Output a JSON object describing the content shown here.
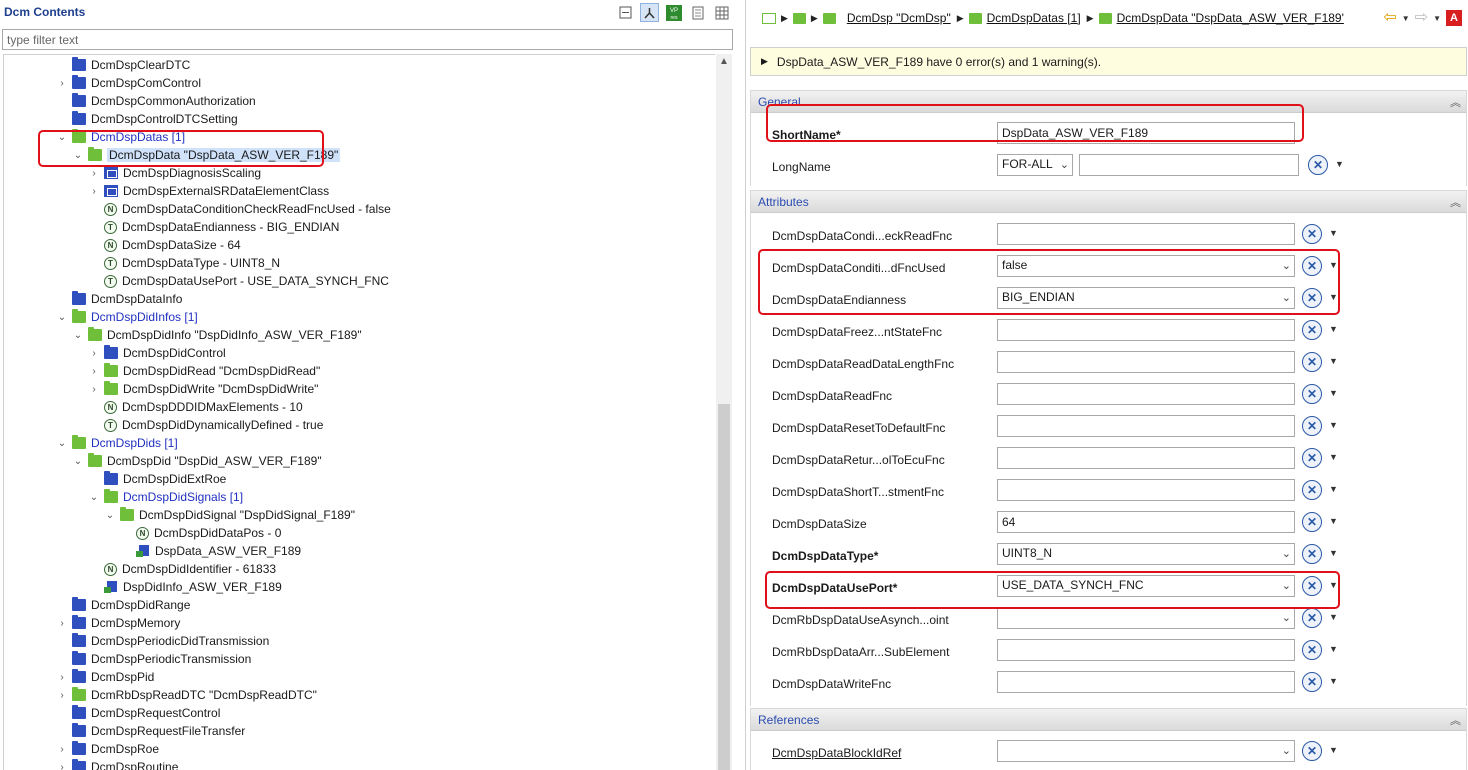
{
  "left": {
    "title": "Dcm Contents",
    "filter_placeholder": "type filter text",
    "toolbar": {
      "collapse_icon": "collapse-all-icon",
      "link_icon": "link-with-editor-icon",
      "vp_label": "VP res",
      "doc_icon": "document-icon",
      "grid_icon": "table-icon"
    },
    "tree": [
      {
        "label": "DcmDspClearDTC",
        "icon": "folder-blue",
        "indent": 0,
        "twisty": ""
      },
      {
        "label": "DcmDspComControl",
        "icon": "folder-blue",
        "indent": 0,
        "twisty": "›"
      },
      {
        "label": "DcmDspCommonAuthorization",
        "icon": "folder-blue",
        "indent": 0,
        "twisty": ""
      },
      {
        "label": "DcmDspControlDTCSetting",
        "icon": "folder-blue",
        "indent": 0,
        "twisty": ""
      },
      {
        "label": "DcmDspDatas [1]",
        "icon": "folder-green",
        "indent": 0,
        "twisty": "⌄",
        "style": "blue"
      },
      {
        "label": "DcmDspData \"DspData_ASW_VER_F189\"",
        "icon": "folder-green",
        "indent": 1,
        "twisty": "⌄",
        "style": "selected"
      },
      {
        "label": "DcmDspDiagnosisScaling",
        "icon": "grid",
        "indent": 2,
        "twisty": "›"
      },
      {
        "label": "DcmDspExternalSRDataElementClass",
        "icon": "grid",
        "indent": 2,
        "twisty": "›"
      },
      {
        "label": "DcmDspDataConditionCheckReadFncUsed - false",
        "icon": "N",
        "indent": 2,
        "twisty": ""
      },
      {
        "label": "DcmDspDataEndianness - BIG_ENDIAN",
        "icon": "T",
        "indent": 2,
        "twisty": ""
      },
      {
        "label": "DcmDspDataSize - 64",
        "icon": "N",
        "indent": 2,
        "twisty": ""
      },
      {
        "label": "DcmDspDataType - UINT8_N",
        "icon": "T",
        "indent": 2,
        "twisty": ""
      },
      {
        "label": "DcmDspDataUsePort - USE_DATA_SYNCH_FNC",
        "icon": "T",
        "indent": 2,
        "twisty": ""
      },
      {
        "label": "DcmDspDataInfo",
        "icon": "folder-blue",
        "indent": 0,
        "twisty": ""
      },
      {
        "label": "DcmDspDidInfos [1]",
        "icon": "folder-green",
        "indent": 0,
        "twisty": "⌄",
        "style": "blue"
      },
      {
        "label": "DcmDspDidInfo \"DspDidInfo_ASW_VER_F189\"",
        "icon": "folder-green",
        "indent": 1,
        "twisty": "⌄"
      },
      {
        "label": "DcmDspDidControl",
        "icon": "folder-blue",
        "indent": 2,
        "twisty": "›"
      },
      {
        "label": "DcmDspDidRead \"DcmDspDidRead\"",
        "icon": "folder-green",
        "indent": 2,
        "twisty": "›"
      },
      {
        "label": "DcmDspDidWrite \"DcmDspDidWrite\"",
        "icon": "folder-green",
        "indent": 2,
        "twisty": "›"
      },
      {
        "label": "DcmDspDDDIDMaxElements - 10",
        "icon": "N",
        "indent": 2,
        "twisty": ""
      },
      {
        "label": "DcmDspDidDynamicallyDefined - true",
        "icon": "T",
        "indent": 2,
        "twisty": ""
      },
      {
        "label": "DcmDspDids [1]",
        "icon": "folder-green",
        "indent": 0,
        "twisty": "⌄",
        "style": "blue"
      },
      {
        "label": "DcmDspDid \"DspDid_ASW_VER_F189\"",
        "icon": "folder-green",
        "indent": 1,
        "twisty": "⌄"
      },
      {
        "label": "DcmDspDidExtRoe",
        "icon": "folder-blue",
        "indent": 2,
        "twisty": ""
      },
      {
        "label": "DcmDspDidSignals [1]",
        "icon": "folder-green",
        "indent": 2,
        "twisty": "⌄",
        "style": "blue"
      },
      {
        "label": "DcmDspDidSignal \"DspDidSignal_F189\"",
        "icon": "folder-green",
        "indent": 3,
        "twisty": "⌄"
      },
      {
        "label": "DcmDspDidDataPos - 0",
        "icon": "N",
        "indent": 4,
        "twisty": ""
      },
      {
        "label": "DspData_ASW_VER_F189",
        "icon": "ref",
        "indent": 4,
        "twisty": ""
      },
      {
        "label": "DcmDspDidIdentifier - 61833",
        "icon": "N",
        "indent": 2,
        "twisty": ""
      },
      {
        "label": "DspDidInfo_ASW_VER_F189",
        "icon": "ref",
        "indent": 2,
        "twisty": ""
      },
      {
        "label": "DcmDspDidRange",
        "icon": "folder-blue",
        "indent": 0,
        "twisty": ""
      },
      {
        "label": "DcmDspMemory",
        "icon": "folder-blue",
        "indent": 0,
        "twisty": "›"
      },
      {
        "label": "DcmDspPeriodicDidTransmission",
        "icon": "folder-blue",
        "indent": 0,
        "twisty": ""
      },
      {
        "label": "DcmDspPeriodicTransmission",
        "icon": "folder-blue",
        "indent": 0,
        "twisty": ""
      },
      {
        "label": "DcmDspPid",
        "icon": "folder-blue",
        "indent": 0,
        "twisty": "›"
      },
      {
        "label": "DcmRbDspReadDTC \"DcmDspReadDTC\"",
        "icon": "folder-green",
        "indent": 0,
        "twisty": "›"
      },
      {
        "label": "DcmDspRequestControl",
        "icon": "folder-blue",
        "indent": 0,
        "twisty": ""
      },
      {
        "label": "DcmDspRequestFileTransfer",
        "icon": "folder-blue",
        "indent": 0,
        "twisty": ""
      },
      {
        "label": "DcmDspRoe",
        "icon": "folder-blue",
        "indent": 0,
        "twisty": "›"
      },
      {
        "label": "DcmDspRoutine",
        "icon": "folder-blue",
        "indent": 0,
        "twisty": "›"
      }
    ]
  },
  "right": {
    "breadcrumb": [
      {
        "label": "DcmDsp \"DcmDsp\""
      },
      {
        "label": "DcmDspDatas [1]"
      },
      {
        "label": "DcmDspData \"DspData_ASW_VER_F189'"
      }
    ],
    "message": "DspData_ASW_VER_F189 have 0 error(s) and 1 warning(s).",
    "error_badge": "A",
    "sections": {
      "general": {
        "title": "General",
        "shortname_label": "ShortName*",
        "shortname_value": "DspData_ASW_VER_F189",
        "longname_label": "LongName",
        "longname_lang": "FOR-ALL",
        "longname_value": ""
      },
      "attributes": {
        "title": "Attributes",
        "rows": [
          {
            "label": "DcmDspDataCondi...eckReadFnc",
            "kind": "text",
            "value": "",
            "bold": false
          },
          {
            "label": "DcmDspDataConditi...dFncUsed",
            "kind": "combo",
            "value": "false",
            "bold": false
          },
          {
            "label": "DcmDspDataEndianness",
            "kind": "combo",
            "value": "BIG_ENDIAN",
            "bold": false
          },
          {
            "label": "DcmDspDataFreez...ntStateFnc",
            "kind": "text",
            "value": "",
            "bold": false
          },
          {
            "label": "DcmDspDataReadDataLengthFnc",
            "kind": "text",
            "value": "",
            "bold": false
          },
          {
            "label": "DcmDspDataReadFnc",
            "kind": "text",
            "value": "",
            "bold": false
          },
          {
            "label": "DcmDspDataResetToDefaultFnc",
            "kind": "text",
            "value": "",
            "bold": false
          },
          {
            "label": "DcmDspDataRetur...olToEcuFnc",
            "kind": "text",
            "value": "",
            "bold": false
          },
          {
            "label": "DcmDspDataShortT...stmentFnc",
            "kind": "text",
            "value": "",
            "bold": false
          },
          {
            "label": "DcmDspDataSize",
            "kind": "text",
            "value": "64",
            "bold": false
          },
          {
            "label": "DcmDspDataType*",
            "kind": "combo",
            "value": "UINT8_N",
            "bold": true
          },
          {
            "label": "DcmDspDataUsePort*",
            "kind": "combo",
            "value": "USE_DATA_SYNCH_FNC",
            "bold": true
          },
          {
            "label": "DcmRbDspDataUseAsynch...oint",
            "kind": "combo",
            "value": "",
            "bold": false
          },
          {
            "label": "DcmRbDspDataArr...SubElement",
            "kind": "text",
            "value": "",
            "bold": false
          },
          {
            "label": "DcmDspDataWriteFnc",
            "kind": "text",
            "value": "",
            "bold": false
          }
        ]
      },
      "references": {
        "title": "References",
        "rows": [
          {
            "label": "DcmDspDataBlockIdRef",
            "kind": "combo",
            "value": ""
          }
        ]
      }
    },
    "highlight_color": "#e0101a"
  }
}
